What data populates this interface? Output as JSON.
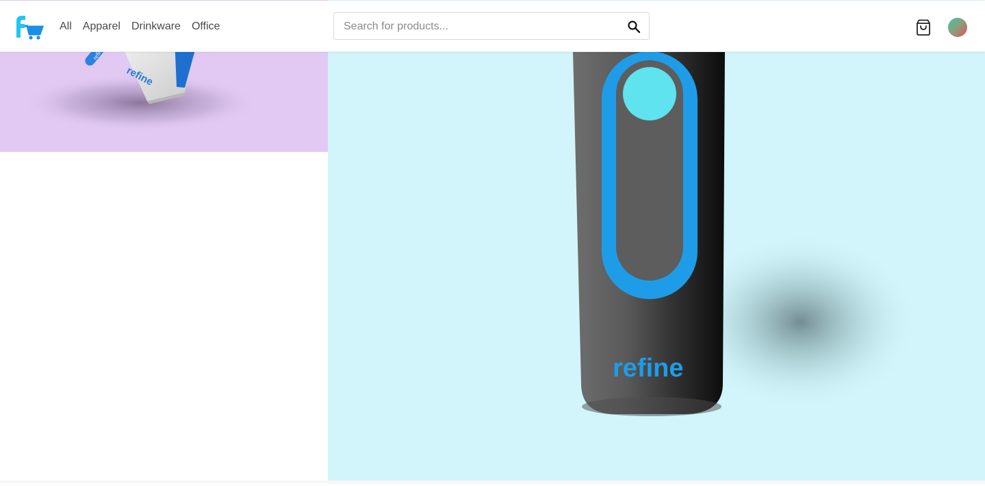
{
  "header": {
    "logo_icon": "refine-cart-logo-icon",
    "nav": [
      {
        "label": "All"
      },
      {
        "label": "Apparel"
      },
      {
        "label": "Drinkware"
      },
      {
        "label": "Office"
      }
    ],
    "search": {
      "placeholder": "Search for products...",
      "value": "",
      "icon": "search-icon"
    },
    "cart_icon": "shopping-bag-icon",
    "avatar_icon": "user-avatar"
  },
  "products": [
    {
      "image": "notebook-and-pen-product-image",
      "brand_mark": "refine",
      "background": "#e1c9f3"
    },
    {
      "image": "water-bottle-product-image",
      "brand_mark": "refine",
      "background": "#d1f5fa"
    }
  ],
  "colors": {
    "accent": "#1e9ce8",
    "cyan": "#5ee3ef",
    "logo": "#29b6f6"
  }
}
